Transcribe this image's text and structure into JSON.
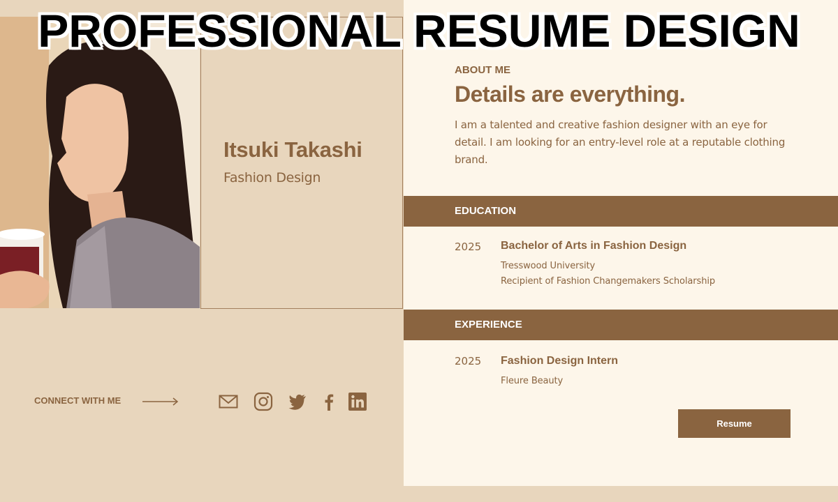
{
  "banner": {
    "title": "PROFESSIONAL RESUME DESIGN"
  },
  "profile": {
    "name": "Itsuki Takashi",
    "role": "Fashion Design"
  },
  "about": {
    "heading": "ABOUT ME",
    "title": "Details are everything.",
    "text": "I am a talented and creative fashion designer with an eye for detail. I am looking for an entry-level role at a reputable clothing brand."
  },
  "education": {
    "heading": "EDUCATION",
    "entries": [
      {
        "year": "2025",
        "title": "Bachelor of Arts in Fashion Design",
        "lines": [
          "Tresswood University",
          "Recipient of Fashion Changemakers Scholarship"
        ]
      }
    ]
  },
  "experience": {
    "heading": "EXPERIENCE",
    "entries": [
      {
        "year": "2025",
        "title": "Fashion Design Intern",
        "lines": [
          "Fleure Beauty"
        ]
      }
    ]
  },
  "connect": {
    "label": "CONNECT WITH ME",
    "icons": [
      "mail-icon",
      "instagram-icon",
      "twitter-icon",
      "facebook-icon",
      "linkedin-icon"
    ]
  },
  "actions": {
    "resume_label": "Resume"
  },
  "colors": {
    "page_background": "#e8d6bd",
    "panel_background": "#fdf6ea",
    "accent_brown": "#8a6440",
    "banner_text": "#000000"
  }
}
